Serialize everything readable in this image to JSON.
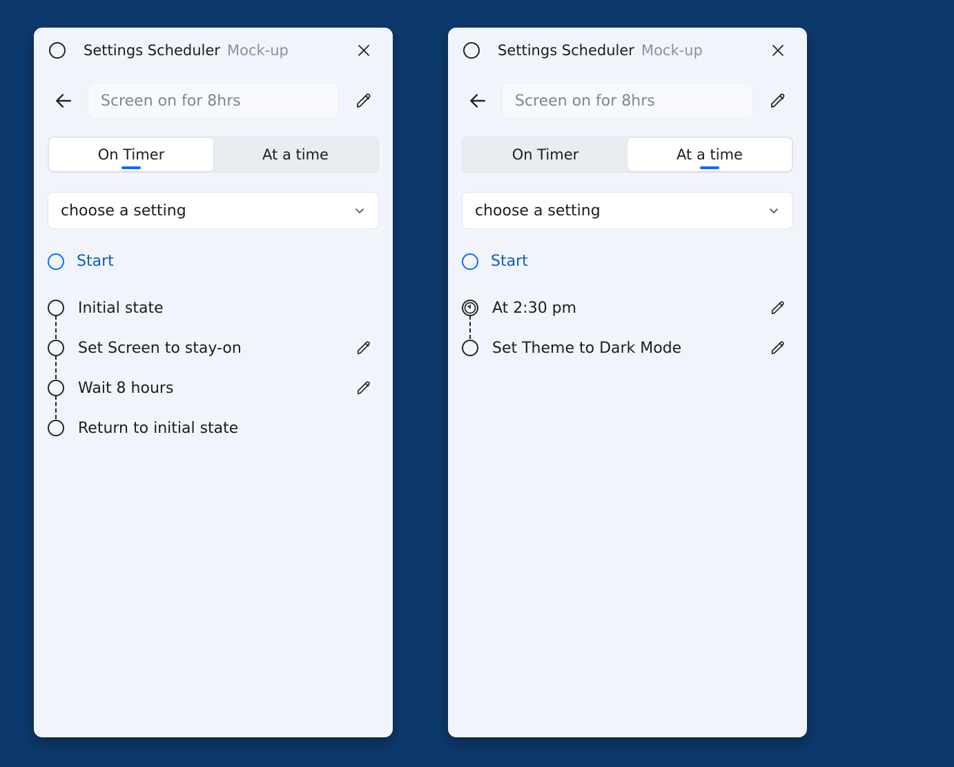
{
  "titlebar": {
    "title": "Settings Scheduler",
    "subtitle": "Mock-up"
  },
  "name_field": {
    "placeholder": "Screen on for 8hrs"
  },
  "tabs": {
    "on_timer": "On Timer",
    "at_a_time": "At a time"
  },
  "select": {
    "placeholder": "choose a setting"
  },
  "start": {
    "label": "Start"
  },
  "left_panel": {
    "active_tab": "on_timer",
    "steps": [
      {
        "label": "Initial state",
        "editable": false
      },
      {
        "label": "Set Screen to stay-on",
        "editable": true
      },
      {
        "label": "Wait 8 hours",
        "editable": true
      },
      {
        "label": "Return to initial state",
        "editable": false
      }
    ]
  },
  "right_panel": {
    "active_tab": "at_a_time",
    "steps": [
      {
        "label": "At 2:30 pm",
        "editable": true,
        "icon": "clock"
      },
      {
        "label": "Set Theme to Dark Mode",
        "editable": true
      }
    ]
  }
}
